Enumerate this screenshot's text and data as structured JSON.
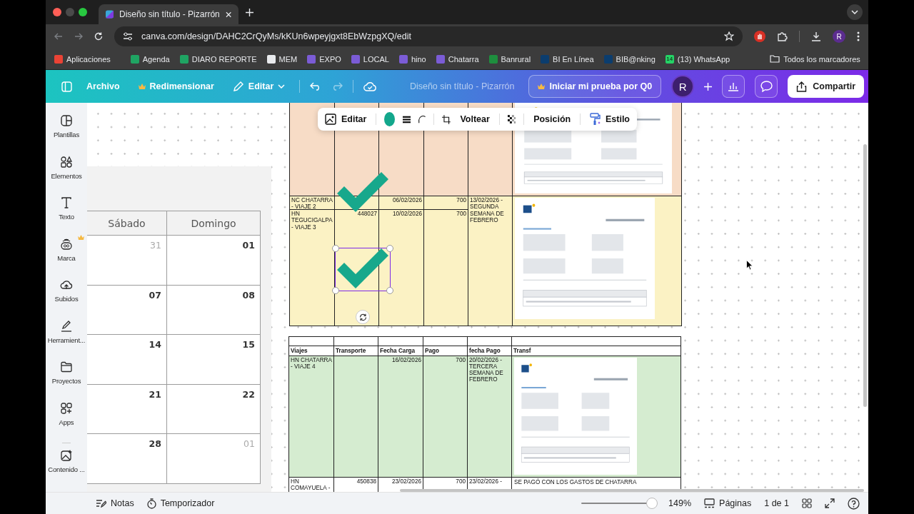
{
  "browser": {
    "tabs": [
      {
        "title": "Diseño sin título - Pizarrón",
        "selected": true
      }
    ],
    "url": "canva.com/design/DAHC2CrQyMs/kKUn6wpeyjgxt8EbWzpgXQ/edit",
    "profile": "R",
    "bookmarks": [
      {
        "label": "Aplicaciones",
        "color": "#ea4335"
      },
      {
        "label": "Agenda",
        "color": "#1fa463"
      },
      {
        "label": "DIARO REPORTE",
        "color": "#1fa463"
      },
      {
        "label": "MEM",
        "color": "#e8eaed"
      },
      {
        "label": "EXPO",
        "color": "#7b5cd6"
      },
      {
        "label": "LOCAL",
        "color": "#7b5cd6"
      },
      {
        "label": "hino",
        "color": "#7b5cd6"
      },
      {
        "label": "Chatarra",
        "color": "#7b5cd6"
      },
      {
        "label": "Banrural",
        "color": "#1e8e3e"
      },
      {
        "label": "BI En Línea",
        "color": "#0b3d6e"
      },
      {
        "label": "BIB@nking",
        "color": "#0b3d6e"
      },
      {
        "label": "(13) WhatsApp",
        "color": "#25d366",
        "badge": "14"
      }
    ],
    "all_bookmarks": "Todos los marcadores"
  },
  "header": {
    "menu": [
      {
        "label": "Archivo",
        "premium": false,
        "dropdown": false
      },
      {
        "label": "Redimensionar",
        "premium": true,
        "dropdown": false
      },
      {
        "label": "Editar",
        "premium": false,
        "dropdown": true
      }
    ],
    "title": "Diseño sin título - Pizarrón",
    "trial": "Iniciar mi prueba por Q0",
    "avatar": "R",
    "share": "Compartir"
  },
  "sidebar": [
    {
      "label": "Plantillas",
      "premium": false
    },
    {
      "label": "Elementos",
      "premium": false
    },
    {
      "label": "Texto",
      "premium": false
    },
    {
      "label": "Marca",
      "premium": true
    },
    {
      "label": "Subidos",
      "premium": false
    },
    {
      "label": "Herramient...",
      "premium": false
    },
    {
      "label": "Proyectos",
      "premium": false
    },
    {
      "label": "Apps",
      "premium": false
    },
    {
      "label": "Contenido ...",
      "premium": false
    }
  ],
  "floating_toolbar": {
    "edit": "Editar",
    "flip": "Voltear",
    "position": "Posición",
    "style": "Estilo"
  },
  "calendar": {
    "days": [
      "Sábado",
      "Domingo"
    ],
    "weeks": [
      [
        {
          "date": "31",
          "outside": true
        },
        {
          "date": "01",
          "outside": false
        }
      ],
      [
        {
          "date": "07",
          "outside": false
        },
        {
          "date": "08",
          "outside": false
        }
      ],
      [
        {
          "date": "14",
          "outside": false
        },
        {
          "date": "15",
          "outside": false
        }
      ],
      [
        {
          "date": "21",
          "outside": false
        },
        {
          "date": "22",
          "outside": false
        }
      ],
      [
        {
          "date": "28",
          "outside": false
        },
        {
          "date": "01",
          "outside": true
        }
      ]
    ]
  },
  "table_upper": {
    "top_row": {
      "color": "#f7dcc6"
    },
    "group": {
      "color": "#fbf2c4",
      "fecha_pago": "13/02/2026 - SEGUNDA SEMANA DE FEBRERO",
      "rows": [
        {
          "viajes": "NC CHATARRA - VIAJE 2",
          "fecha_carga": "06/02/2026",
          "pago": "700"
        },
        {
          "viajes": "HN TEGUCIGALPA - VIAJE 3",
          "transporte": "448027",
          "fecha_carga": "10/02/2026",
          "pago": "700"
        }
      ]
    }
  },
  "table_lower": {
    "columns": [
      "Viajes",
      "Transporte",
      "Fecha Carga",
      "Pago",
      "fecha Pago",
      "Transf"
    ],
    "rows": [
      {
        "color": "#d5ecd0",
        "viajes": "HN CHATARRA - VIAJE 4",
        "fecha_carga": "16/02/2026",
        "pago": "700",
        "fecha_pago": "20/02/2026 - TERCERA SEMANA DE FEBRERO"
      },
      {
        "color": "#ffffff",
        "viajes": "HN COMAYUELA -",
        "transporte": "450838",
        "fecha_carga": "23/02/2026",
        "pago": "700",
        "fecha_pago": "23/02/2026 -",
        "transf": {
          "kind": "text",
          "text": "SE PAGÓ CON LOS GASTOS DE CHATARRA"
        }
      }
    ]
  },
  "status_bar": {
    "notes": "Notas",
    "timer": "Temporizador",
    "zoom_slider": {
      "level": 0.95
    },
    "zoom": "149%",
    "pages": "Páginas",
    "page_count": "1 de 1"
  }
}
